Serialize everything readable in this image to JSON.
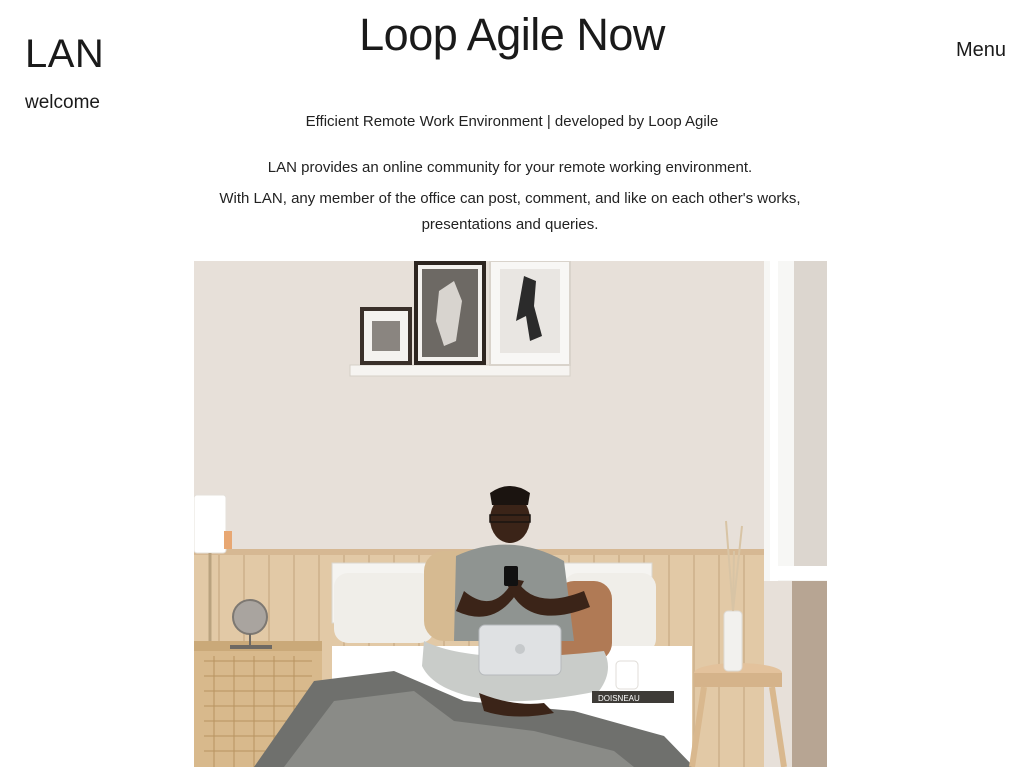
{
  "brand": {
    "logo": "LAN",
    "subtitle": "welcome"
  },
  "header": {
    "title": "Loop Agile Now",
    "menu_label": "Menu"
  },
  "intro": {
    "tagline": "Efficient Remote Work Environment | developed by Loop Agile",
    "paragraph_1": "LAN provides an online community for your remote working environment.",
    "paragraph_2": "With LAN, any member of the office can post, comment, and like on each other's works, presentations and queries."
  },
  "hero": {
    "book_text": "DOISNEAU"
  },
  "colors": {
    "text": "#1a1a1a",
    "background": "#ffffff",
    "wall": "#e9e3dc",
    "wood": "#e2c9a6"
  }
}
